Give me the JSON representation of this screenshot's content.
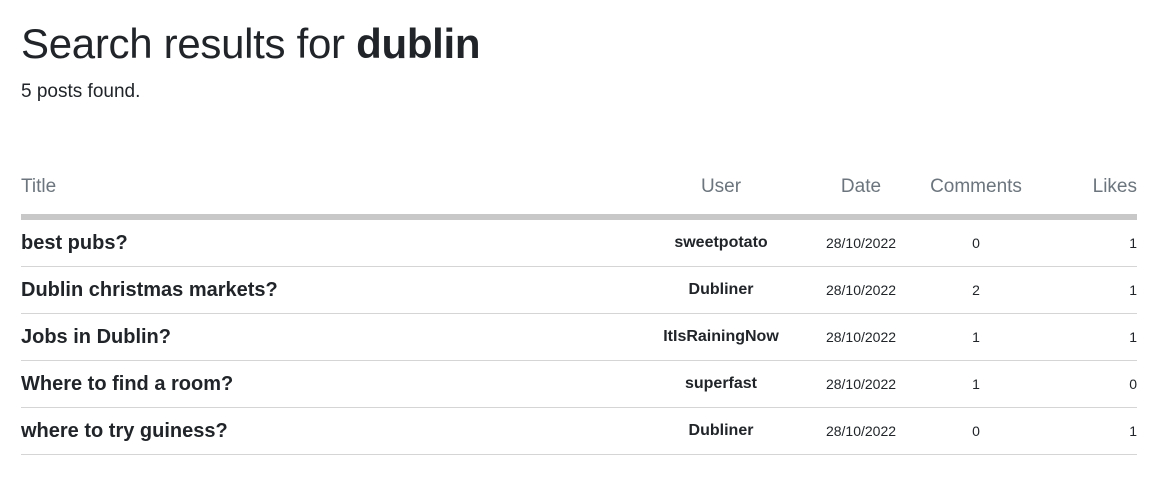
{
  "heading": {
    "prefix": "Search results for ",
    "query": "dublin"
  },
  "result_count": "5 posts found.",
  "table": {
    "headers": {
      "title": "Title",
      "user": "User",
      "date": "Date",
      "comments": "Comments",
      "likes": "Likes"
    },
    "rows": [
      {
        "title": "best pubs?",
        "user": "sweetpotato",
        "date": "28/10/2022",
        "comments": "0",
        "likes": "1"
      },
      {
        "title": "Dublin christmas markets?",
        "user": "Dubliner",
        "date": "28/10/2022",
        "comments": "2",
        "likes": "1"
      },
      {
        "title": "Jobs in Dublin?",
        "user": "ItIsRainingNow",
        "date": "28/10/2022",
        "comments": "1",
        "likes": "1"
      },
      {
        "title": "Where to find a room?",
        "user": "superfast",
        "date": "28/10/2022",
        "comments": "1",
        "likes": "0"
      },
      {
        "title": "where to try guiness?",
        "user": "Dubliner",
        "date": "28/10/2022",
        "comments": "0",
        "likes": "1"
      }
    ]
  }
}
